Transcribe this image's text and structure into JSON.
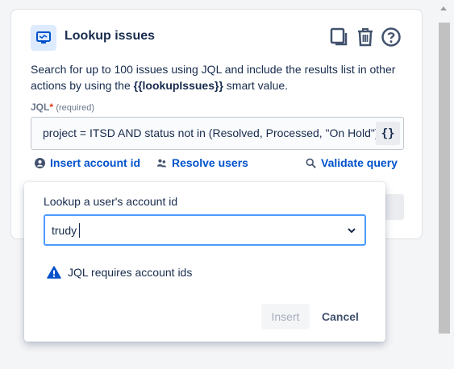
{
  "header": {
    "title": "Lookup issues",
    "icon": "monitor-icon",
    "actions": [
      "copy-icon",
      "delete-icon",
      "help-icon"
    ]
  },
  "description": {
    "before": "Search for up to 100 issues using JQL and include the results list in other actions by using the ",
    "smart_value": "{{lookupIssues}}",
    "after": " smart value."
  },
  "jql": {
    "label": "JQL",
    "required_mark": "*",
    "required_text": "(required)",
    "value": "project = ITSD AND status not in (Resolved, Processed, \"On Hold\")",
    "braces_label": "{}"
  },
  "links": {
    "insert_account_id": "Insert account id",
    "resolve_users": "Resolve users",
    "validate_query": "Validate query"
  },
  "popup": {
    "label": "Lookup a user's account id",
    "input_value": "trudy",
    "warning": "JQL requires account ids",
    "insert_button": "Insert",
    "cancel_button": "Cancel"
  },
  "colors": {
    "link": "#0052cc",
    "warning_icon": "#0052cc",
    "focus_border": "#4c9aff",
    "header_icon_bg": "#deebff"
  }
}
